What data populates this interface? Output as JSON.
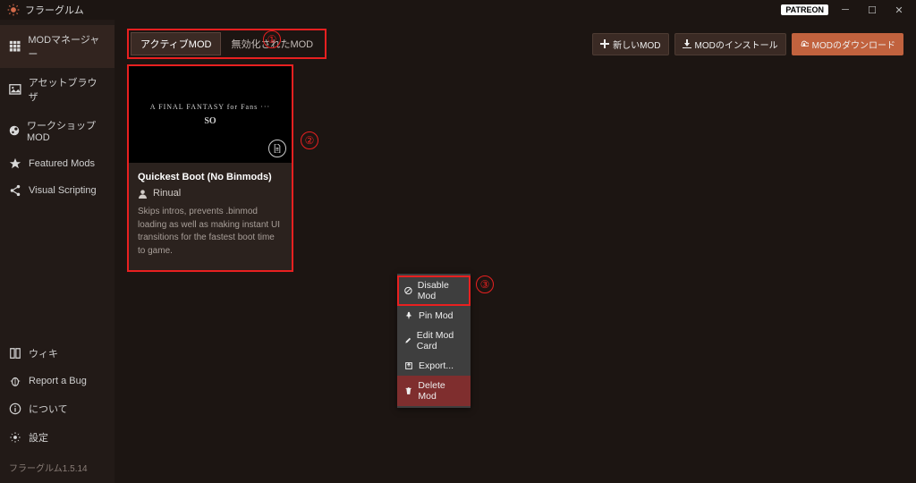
{
  "app": {
    "title": "フラーグルム"
  },
  "window": {
    "patreonLabel": "PATREON"
  },
  "sidebar": {
    "items": [
      {
        "label": "MODマネージャー"
      },
      {
        "label": "アセットブラウザ"
      },
      {
        "label": "ワークショップMOD"
      },
      {
        "label": "Featured Mods"
      },
      {
        "label": "Visual Scripting"
      }
    ],
    "bottom": [
      {
        "label": "ウィキ"
      },
      {
        "label": "Report a Bug"
      },
      {
        "label": "について"
      },
      {
        "label": "設定"
      }
    ],
    "version": "フラーグルム1.5.14"
  },
  "tabs": {
    "active": "アクティブMOD",
    "disabled": "無効化されたMOD"
  },
  "toolbar": {
    "newMod": "新しいMOD",
    "installMod": "MODのインストール",
    "downloadMods": "MODのダウンロード"
  },
  "mod": {
    "imageLine1": "A FINAL FANTASY for Fans ···",
    "imageLine2": "SO",
    "title": "Quickest Boot (No Binmods)",
    "author": "Rinual",
    "description": "Skips intros, prevents .binmod loading as well as making instant UI transitions for the fastest boot time to game."
  },
  "context": {
    "disable": "Disable Mod",
    "pin": "Pin Mod",
    "edit": "Edit Mod Card",
    "export": "Export...",
    "delete": "Delete Mod"
  },
  "annotations": {
    "one": "①",
    "two": "②",
    "three": "③"
  }
}
